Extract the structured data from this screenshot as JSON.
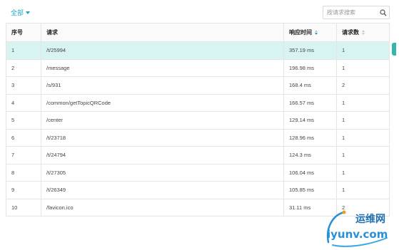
{
  "toolbar": {
    "filter_label": "全部",
    "search": {
      "placeholder": "按请求搜索",
      "value": ""
    }
  },
  "table": {
    "headers": {
      "index": "序号",
      "request": "请求",
      "response_time": "响应时间",
      "count": "请求数"
    },
    "sorted_by": "response_time",
    "rows": [
      {
        "index": "1",
        "request": "/t/25994",
        "response_time": "357.19 ms",
        "count": "1"
      },
      {
        "index": "2",
        "request": "/message",
        "response_time": "196.98 ms",
        "count": "1"
      },
      {
        "index": "3",
        "request": "/s/931",
        "response_time": "168.4 ms",
        "count": "2"
      },
      {
        "index": "4",
        "request": "/common/getTopicQRCode",
        "response_time": "166.57 ms",
        "count": "1"
      },
      {
        "index": "5",
        "request": "/center",
        "response_time": "129.14 ms",
        "count": "1"
      },
      {
        "index": "6",
        "request": "/t/23718",
        "response_time": "128.96 ms",
        "count": "1"
      },
      {
        "index": "7",
        "request": "/t/24794",
        "response_time": "124.3 ms",
        "count": "1"
      },
      {
        "index": "8",
        "request": "/t/27305",
        "response_time": "106.04 ms",
        "count": "1"
      },
      {
        "index": "9",
        "request": "/t/26349",
        "response_time": "105.85 ms",
        "count": "1"
      },
      {
        "index": "10",
        "request": "/favicon.ico",
        "response_time": "31.11 ms",
        "count": "2"
      }
    ],
    "selected_row": 1
  },
  "watermark": {
    "title": "运维网",
    "url": "iyunv.com"
  },
  "colors": {
    "accent": "#1ba4c0",
    "selected_row": "#d7f4f2",
    "border": "#e5e5e5",
    "edge_tab": "#32b7a8"
  }
}
